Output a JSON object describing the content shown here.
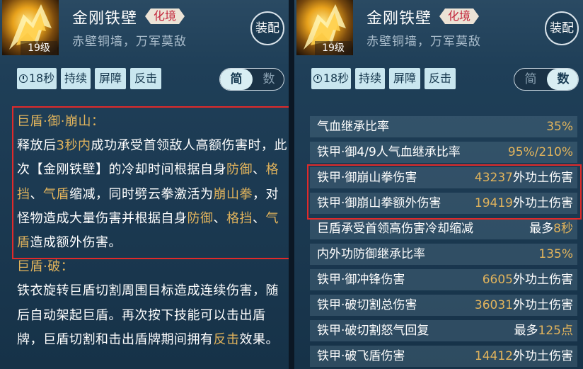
{
  "skill": {
    "name": "金刚铁壁",
    "realm": "化境",
    "subtitle": "赤壁铜墙，万军莫敌",
    "level": "19级",
    "equip_label": "装配"
  },
  "tags": {
    "cooldown": "18秒",
    "items": [
      "持续",
      "屏障",
      "反击"
    ]
  },
  "view_toggle": {
    "options": [
      "简",
      "数"
    ]
  },
  "left_panel": {
    "desc1": {
      "title": "巨盾·御·崩山：",
      "p1": "释放后",
      "h1": "3秒内",
      "p2": "成功承受首领敌人高额伤害时，此次【金刚铁壁】的冷却时间根据自身",
      "h2": "防御",
      "s1": "、",
      "h3": "格挡",
      "s2": "、",
      "h4": "气盾",
      "p3": "缩减，同时劈云拳激活为",
      "h5": "崩山拳",
      "p4": "，对怪物造成大量伤害并根据自身",
      "h6": "防御",
      "s3": "、",
      "h7": "格挡",
      "s4": "、",
      "h8": "气盾",
      "p5": "造成额外伤害。"
    },
    "desc2": {
      "title": "巨盾·破：",
      "p1": "铁衣旋转巨盾切割周围目标造成连续伤害，随后自动架起巨盾。再次按下技能可以击出盾牌，巨盾切割和击出盾牌期间拥有",
      "h1": "反击",
      "p2": "效果。"
    }
  },
  "stats": [
    {
      "label": "气血继承比率",
      "prefix": "",
      "value": "35%",
      "suffix": ""
    },
    {
      "label": "铁甲·御4/9人气血继承比率",
      "prefix": "",
      "value": "95%/210%",
      "suffix": ""
    },
    {
      "label": "铁甲·御崩山拳伤害",
      "prefix": "",
      "value": "43237",
      "suffix": "外功土伤害"
    },
    {
      "label": "铁甲·御崩山拳额外伤害",
      "prefix": "",
      "value": "19419",
      "suffix": "外功土伤害"
    },
    {
      "label": "巨盾承受首领高伤害冷却缩减",
      "prefix": "最多",
      "value": "8秒",
      "suffix": ""
    },
    {
      "label": "内外功防御继承比率",
      "prefix": "",
      "value": "135%",
      "suffix": ""
    },
    {
      "label": "铁甲·御冲锋伤害",
      "prefix": "",
      "value": "6605",
      "suffix": "外功土伤害"
    },
    {
      "label": "铁甲·破切割总伤害",
      "prefix": "",
      "value": "36031",
      "suffix": "外功土伤害"
    },
    {
      "label": "铁甲·破切割怒气回复",
      "prefix": "最多",
      "value": "125点",
      "suffix": ""
    },
    {
      "label": "铁甲·破飞盾伤害",
      "prefix": "",
      "value": "14412",
      "suffix": "外功土伤害"
    }
  ],
  "colors": {
    "highlight": "#e2b45c",
    "realm_tag_text": "#c2243a",
    "annotation_box": "#e02a2a",
    "tag_bg": "#c9e6ef"
  },
  "icons": [
    "skill-shield-icon",
    "clock-icon"
  ]
}
